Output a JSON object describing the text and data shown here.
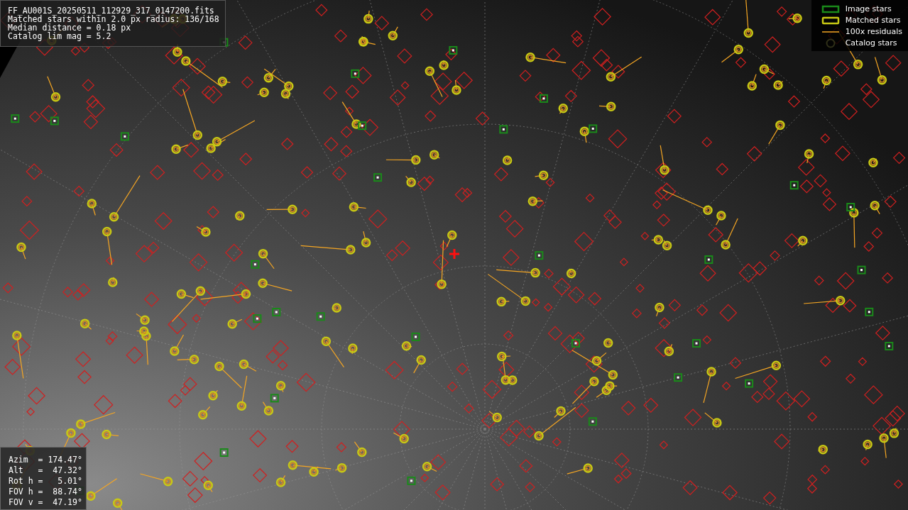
{
  "info_panel": {
    "lines": [
      "FF_AU001S_20250511_112929_317_0147200.fits",
      "Matched stars within 2.0 px radius: 136/168",
      "Median distance = 0.18 px",
      "Catalog lim mag = 5.2"
    ]
  },
  "legend": {
    "items": [
      {
        "kind": "image",
        "label": "Image stars"
      },
      {
        "kind": "matched",
        "label": "Matched stars"
      },
      {
        "kind": "residual",
        "label": "100x residuals"
      },
      {
        "kind": "catalog",
        "label": "Catalog stars"
      }
    ]
  },
  "pointing_panel": {
    "lines": [
      "Azim  = 174.47°",
      "Alt   =  47.32°",
      "Rot h =   5.01°",
      "FOV h =  88.74°",
      "FOV v =  47.19°"
    ]
  }
}
